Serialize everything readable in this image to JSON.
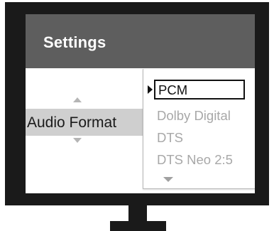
{
  "header": {
    "title": "Settings"
  },
  "setting": {
    "label": "Audio Format"
  },
  "dropdown": {
    "options": [
      "PCM",
      "Dolby Digital",
      "DTS",
      "DTS Neo 2:5"
    ],
    "selected": "PCM"
  },
  "colors": {
    "bezel": "#1a1a1a",
    "header_bg": "#5e5e5e",
    "row_highlight": "#cfcfcf",
    "option_inactive": "#a8a8a8"
  },
  "icons": {
    "pointer": "selection-pointer-icon",
    "up": "arrow-up-icon",
    "down": "arrow-down-icon",
    "more": "more-options-icon"
  }
}
